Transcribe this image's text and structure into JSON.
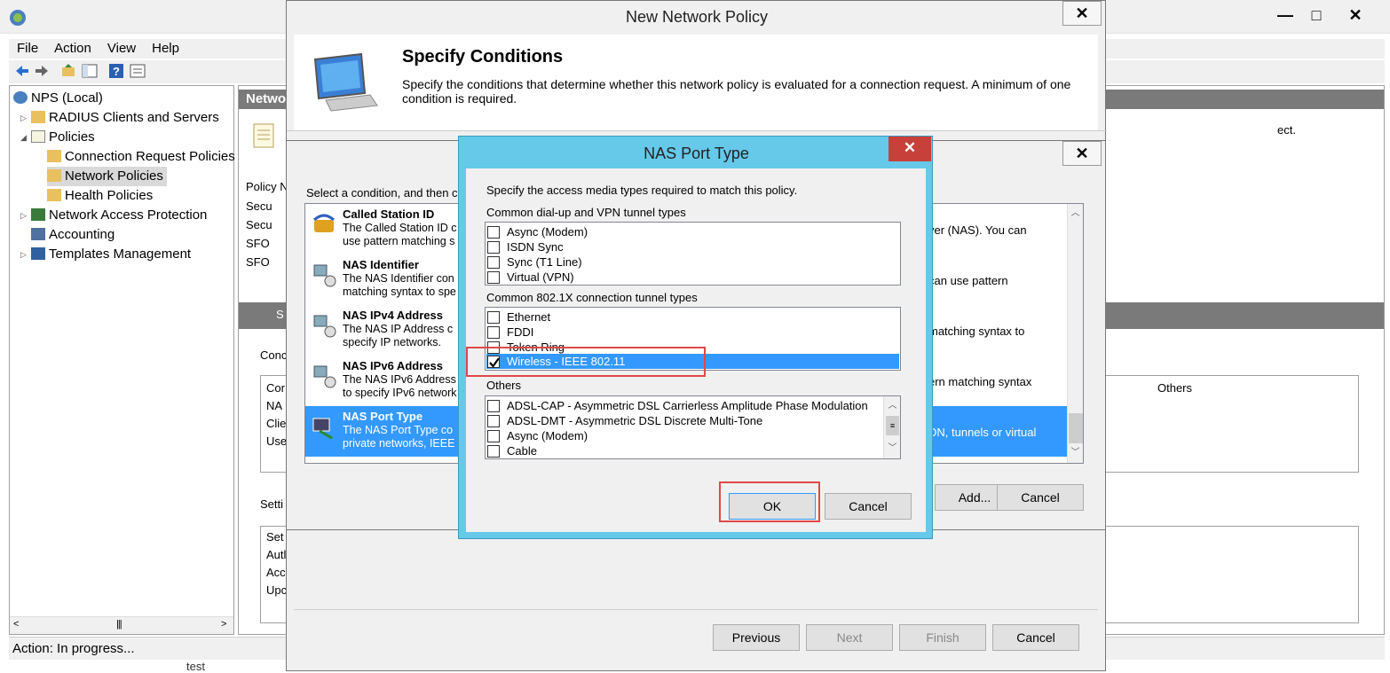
{
  "main": {
    "menu": [
      "File",
      "Action",
      "View",
      "Help"
    ],
    "tree": {
      "root": "NPS (Local)",
      "radius": "RADIUS Clients and Servers",
      "policies": "Policies",
      "crp": "Connection Request Policies",
      "np": "Network Policies",
      "hp": "Health Policies",
      "nap": "Network Access Protection",
      "accounting": "Accounting",
      "templates": "Templates Management"
    },
    "status": "Action:  In progress...",
    "bottom_text": "test",
    "panel_header": "Netwo",
    "panel_text_right": "ect.",
    "policy_col": "Policy N",
    "policies_rows": [
      "Secu",
      "Secu",
      "SFO",
      "SFO"
    ],
    "section2": "S",
    "cond_label": "Conc",
    "cond_rows": [
      "Cor",
      "NA",
      "Clie",
      "Use"
    ],
    "settings_label": "Setti",
    "settings_rows": [
      "Set",
      "Autl",
      "Acc",
      "Upc"
    ],
    "others_col": "Others"
  },
  "wizard": {
    "title": "New Network Policy",
    "heading": "Specify Conditions",
    "description": "Specify the conditions that determine whether this network policy is evaluated for a connection request. A minimum of one condition is required.",
    "buttons": {
      "previous": "Previous",
      "next": "Next",
      "finish": "Finish",
      "cancel": "Cancel"
    }
  },
  "select_condition": {
    "prompt": "Select a condition, and then c",
    "conditions": [
      {
        "title": "Called Station ID",
        "desc": "The Called Station ID c use pattern matching s",
        "right": "ver (NAS). You can"
      },
      {
        "title": "NAS Identifier",
        "desc": "The NAS Identifier con matching syntax to spe",
        "right": "can use pattern"
      },
      {
        "title": "NAS IPv4 Address",
        "desc": "The NAS IP Address c specify IP networks.",
        "right": "matching syntax to"
      },
      {
        "title": "NAS IPv6 Address",
        "desc": "The NAS IPv6 Address to specify IPv6 network",
        "right": "ern matching syntax"
      },
      {
        "title": "NAS Port Type",
        "desc": "The NAS Port Type co private networks, IEEE",
        "right": "DN, tunnels or virtual"
      }
    ],
    "add": "Add...",
    "cancel": "Cancel"
  },
  "nas_dialog": {
    "title": "NAS Port Type",
    "instruction": "Specify the access media types required to match this policy.",
    "group1_label": "Common dial-up and VPN tunnel types",
    "group1": [
      {
        "label": "Async (Modem)",
        "checked": false
      },
      {
        "label": "ISDN Sync",
        "checked": false
      },
      {
        "label": "Sync (T1 Line)",
        "checked": false
      },
      {
        "label": "Virtual (VPN)",
        "checked": false
      }
    ],
    "group2_label": "Common 802.1X connection tunnel types",
    "group2": [
      {
        "label": "Ethernet",
        "checked": false
      },
      {
        "label": "FDDI",
        "checked": false
      },
      {
        "label": "Token Ring",
        "checked": false
      },
      {
        "label": "Wireless - IEEE 802.11",
        "checked": true
      }
    ],
    "others_label": "Others",
    "others": [
      {
        "label": "ADSL-CAP - Asymmetric DSL Carrierless Amplitude Phase Modulation",
        "checked": false
      },
      {
        "label": "ADSL-DMT - Asymmetric DSL Discrete Multi-Tone",
        "checked": false
      },
      {
        "label": "Async (Modem)",
        "checked": false
      },
      {
        "label": "Cable",
        "checked": false
      }
    ],
    "ok": "OK",
    "cancel": "Cancel"
  },
  "colors": {
    "accent": "#3399ff",
    "title_blue": "#66c9ea",
    "close_red": "#c7403a",
    "highlight": "#e04848"
  }
}
